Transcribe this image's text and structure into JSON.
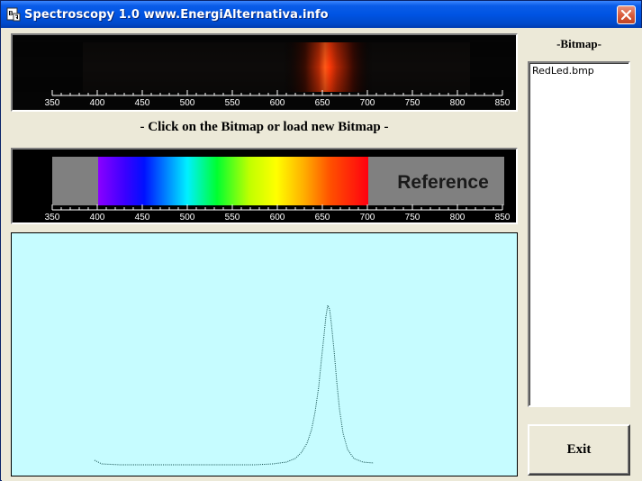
{
  "window": {
    "title": "Spectroscopy 1.0 www.EnergiAlternativa.info",
    "icon": "bitmap-app-icon",
    "close_icon": "close-x-icon"
  },
  "spectrum": {
    "scale_labels": [
      "350",
      "400",
      "450",
      "500",
      "550",
      "600",
      "650",
      "700",
      "750",
      "800",
      "850"
    ],
    "peak_color": "#ff3a10"
  },
  "instruction": "- Click on the Bitmap or load new Bitmap -",
  "reference": {
    "label": "Reference",
    "scale_labels": [
      "350",
      "400",
      "450",
      "500",
      "550",
      "600",
      "650",
      "700",
      "750",
      "800",
      "850"
    ]
  },
  "graph": {
    "background": "#c6fcff",
    "line_color": "#003a3a"
  },
  "sidebar": {
    "bitmap_label": "-Bitmap-",
    "files": [
      "RedLed.bmp"
    ]
  },
  "buttons": {
    "exit_label": "Exit"
  }
}
